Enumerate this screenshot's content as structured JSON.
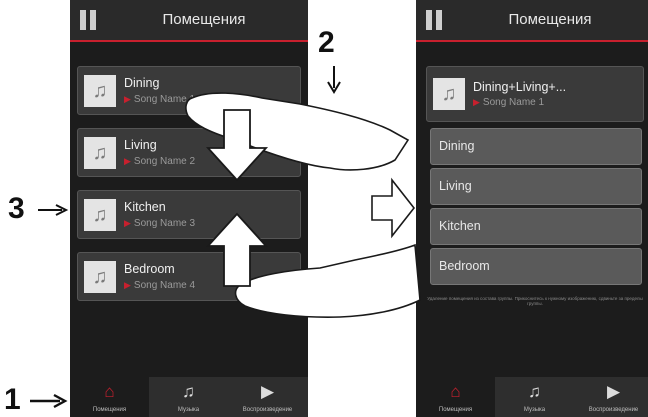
{
  "left_screen": {
    "title": "Помещения",
    "rooms": [
      {
        "name": "Dining",
        "song": "Song Name 1"
      },
      {
        "name": "Living",
        "song": "Song Name 2"
      },
      {
        "name": "Kitchen",
        "song": "Song Name 3"
      },
      {
        "name": "Bedroom",
        "song": "Song Name 4"
      }
    ]
  },
  "right_screen": {
    "title": "Помещения",
    "group": {
      "name": "Dining+Living+...",
      "song": "Song Name 1"
    },
    "members": [
      "Dining",
      "Living",
      "Kitchen",
      "Bedroom"
    ],
    "hint": "Удаление помещения из состава группы. Прикоснитесь к нужному изображению, сдвиньте за пределы группы."
  },
  "tabs": [
    {
      "label": "Помещения",
      "icon": "home-icon",
      "glyph": "⌂"
    },
    {
      "label": "Музыка",
      "icon": "music-note-icon",
      "glyph": "♫"
    },
    {
      "label": "Воспроизведение",
      "icon": "play-icon",
      "glyph": "▶"
    }
  ],
  "callouts": {
    "one": "1",
    "two": "2",
    "three": "3"
  },
  "colors": {
    "accent": "#c8202e",
    "background": "#1c1c1c",
    "card": "#3a3a3a"
  }
}
